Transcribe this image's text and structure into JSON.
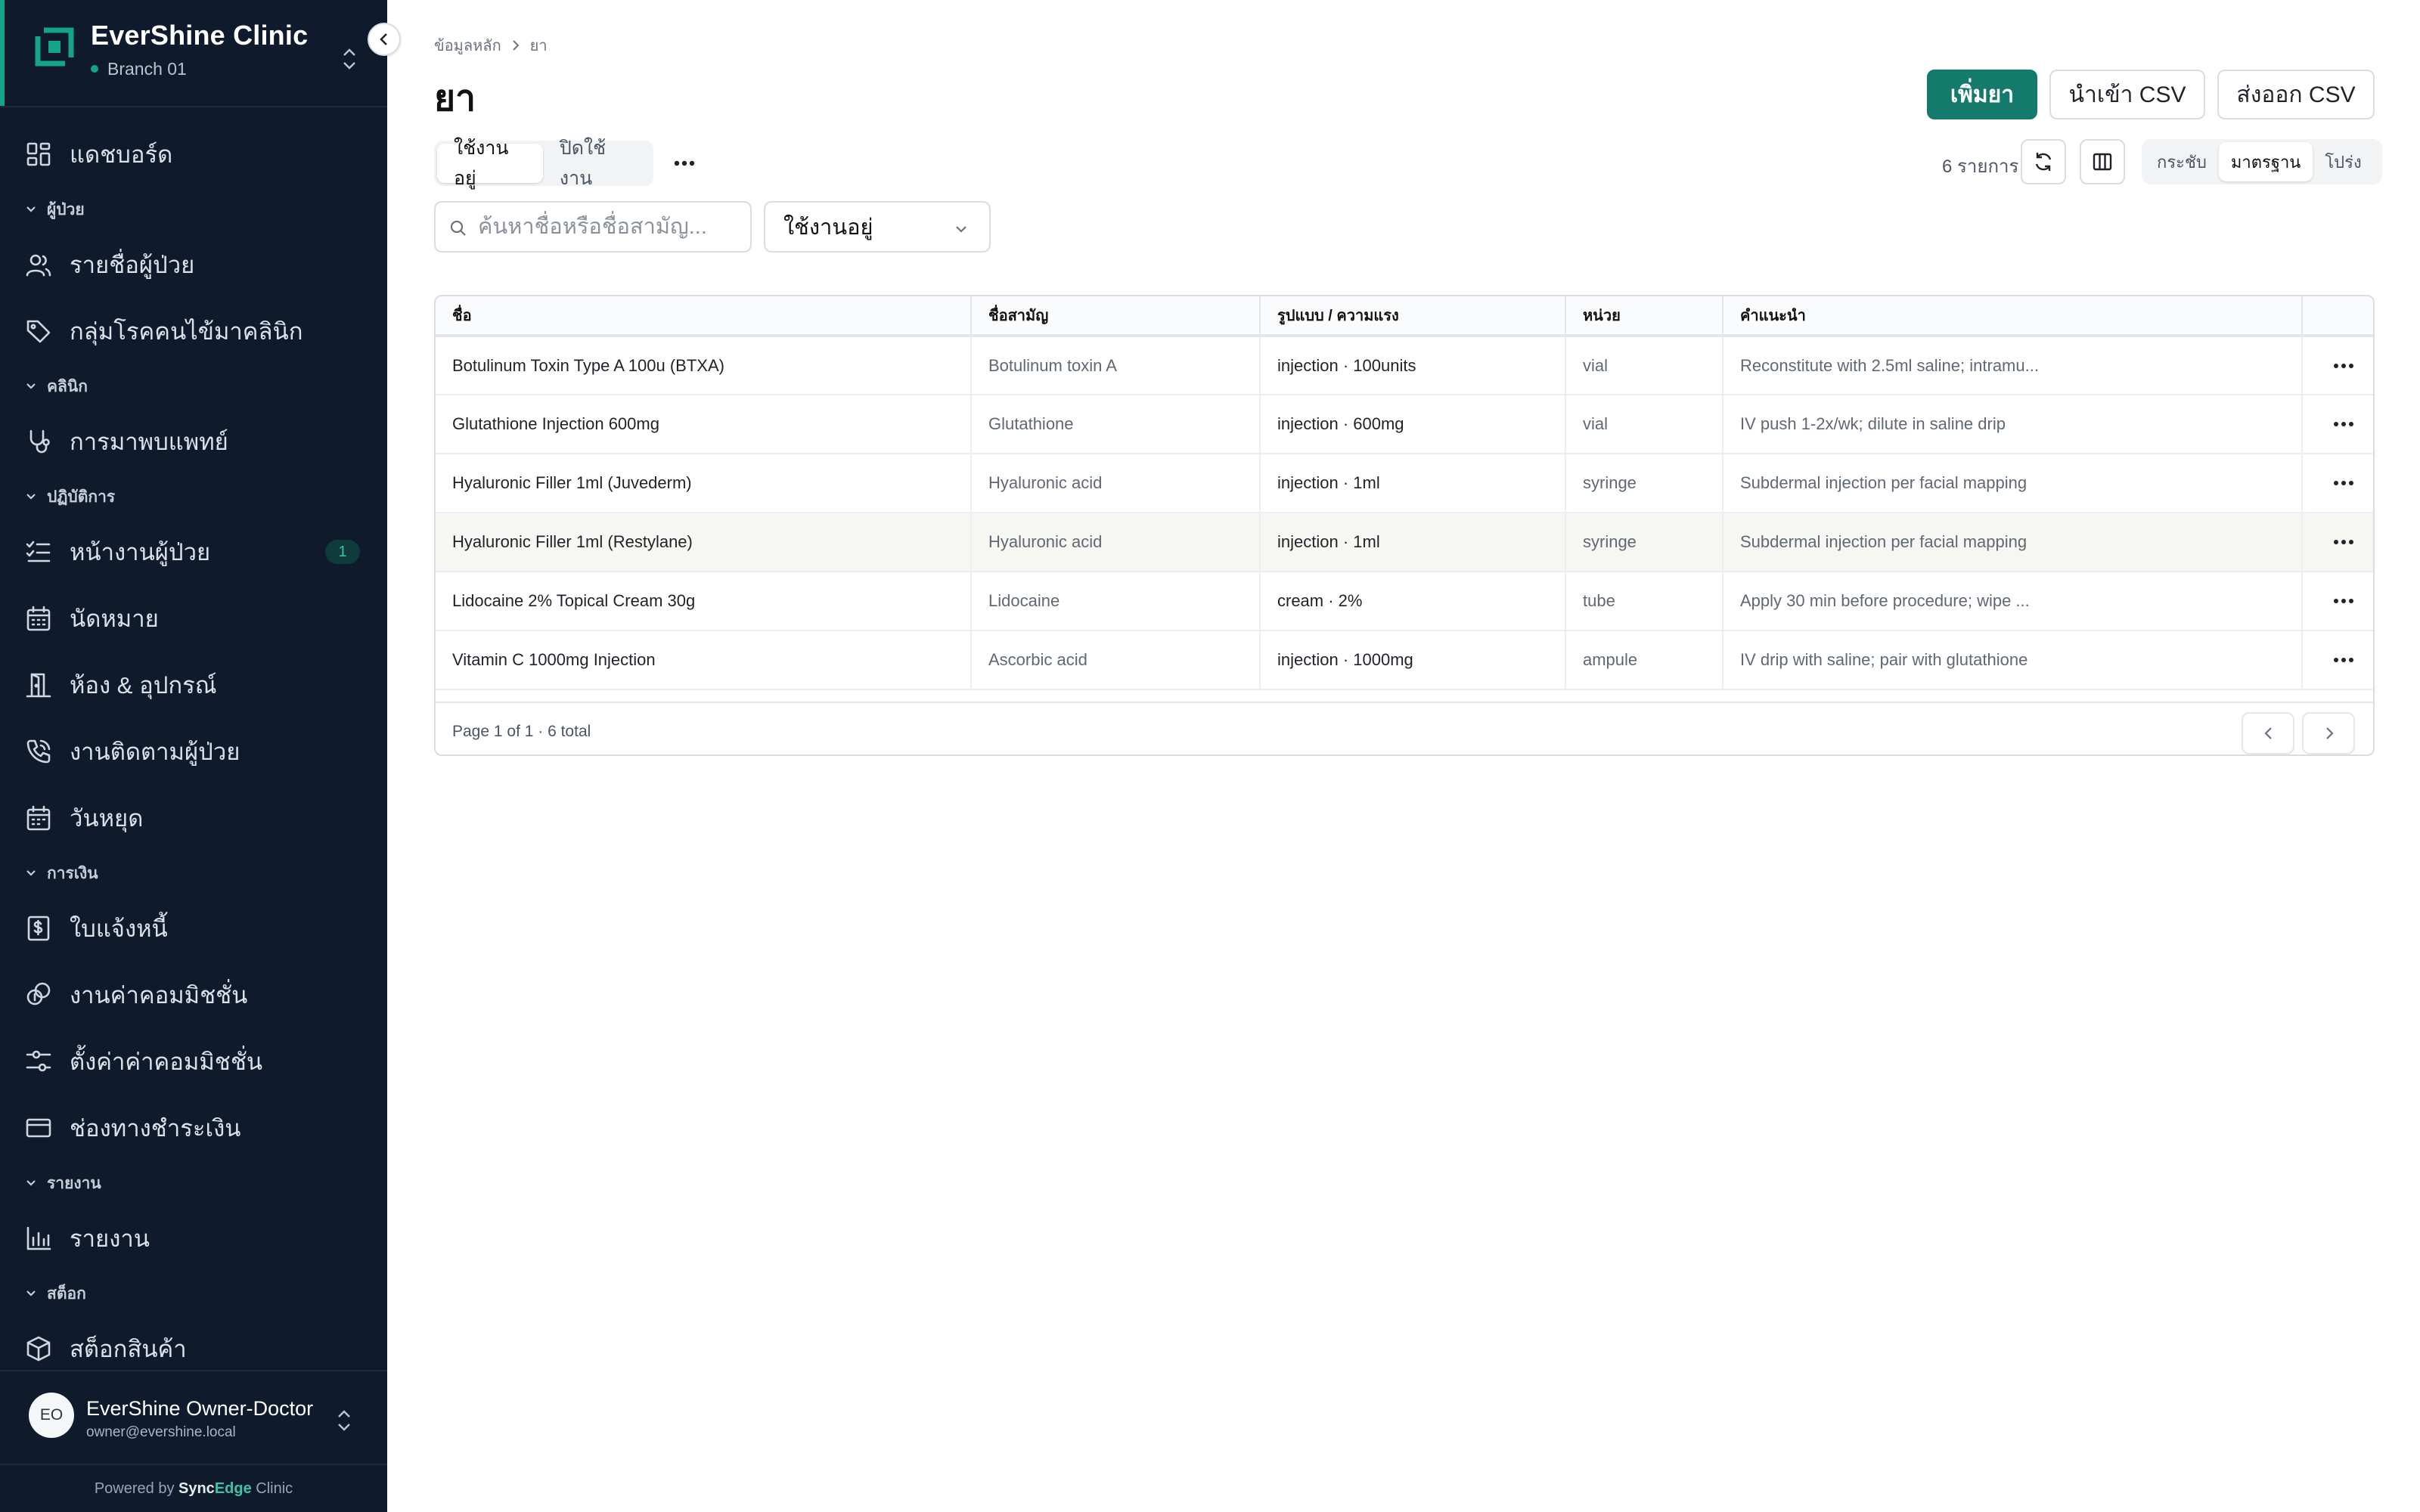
{
  "sidebar": {
    "brand_name": "EverShine Clinic",
    "branch": "Branch 01",
    "nav": [
      {
        "type": "item",
        "label": "แดชบอร์ด",
        "icon": "dashboard-icon"
      },
      {
        "type": "section",
        "label": "ผู้ป่วย"
      },
      {
        "type": "item",
        "label": "รายชื่อผู้ป่วย",
        "icon": "users-icon"
      },
      {
        "type": "item",
        "label": "กลุ่มโรคคนไข้มาคลินิก",
        "icon": "tag-icon"
      },
      {
        "type": "section",
        "label": "คลินิก"
      },
      {
        "type": "item",
        "label": "การมาพบแพทย์",
        "icon": "stethoscope-icon"
      },
      {
        "type": "section",
        "label": "ปฏิบัติการ"
      },
      {
        "type": "item",
        "label": "หน้างานผู้ป่วย",
        "icon": "checklist-icon",
        "badge": "1"
      },
      {
        "type": "item",
        "label": "นัดหมาย",
        "icon": "calendar-icon"
      },
      {
        "type": "item",
        "label": "ห้อง & อุปกรณ์",
        "icon": "door-icon"
      },
      {
        "type": "item",
        "label": "งานติดตามผู้ป่วย",
        "icon": "phone-icon"
      },
      {
        "type": "item",
        "label": "วันหยุด",
        "icon": "calendar-holiday-icon"
      },
      {
        "type": "section",
        "label": "การเงิน"
      },
      {
        "type": "item",
        "label": "ใบแจ้งหนี้",
        "icon": "invoice-icon"
      },
      {
        "type": "item",
        "label": "งานค่าคอมมิชชั่น",
        "icon": "coins-icon"
      },
      {
        "type": "item",
        "label": "ตั้งค่าค่าคอมมิชชั่น",
        "icon": "sliders-icon"
      },
      {
        "type": "item",
        "label": "ช่องทางชำระเงิน",
        "icon": "credit-card-icon"
      },
      {
        "type": "section",
        "label": "รายงาน"
      },
      {
        "type": "item",
        "label": "รายงาน",
        "icon": "bar-chart-icon"
      },
      {
        "type": "section",
        "label": "สต็อก"
      },
      {
        "type": "item",
        "label": "สต็อกสินค้า",
        "icon": "box-icon"
      }
    ],
    "user": {
      "initials": "EO",
      "name": "EverShine Owner-Doctor",
      "email": "owner@evershine.local"
    },
    "powered_prefix": "Powered by ",
    "powered_sync": "Sync",
    "powered_edge": "Edge",
    "powered_suffix": " Clinic"
  },
  "header": {
    "breadcrumb": [
      "ข้อมูลหลัก",
      "ยา"
    ],
    "title": "ยา",
    "add_button": "เพิ่มยา",
    "import_button": "นำเข้า CSV",
    "export_button": "ส่งออก CSV"
  },
  "toolbar": {
    "tabs": [
      "ใช้งานอยู่",
      "ปิดใช้งาน"
    ],
    "active_tab": 0,
    "count": "6 รายการ",
    "density": [
      "กระชับ",
      "มาตรฐาน",
      "โปร่ง"
    ],
    "active_density": 1,
    "search_placeholder": "ค้นหาชื่อหรือชื่อสามัญ...",
    "status_filter": "ใช้งานอยู่"
  },
  "table": {
    "columns": [
      "ชื่อ",
      "ชื่อสามัญ",
      "รูปแบบ / ความแรง",
      "หน่วย",
      "คำแนะนำ"
    ],
    "rows": [
      [
        "Botulinum Toxin Type A 100u (BTXA)",
        "Botulinum toxin A",
        "injection · 100units",
        "vial",
        "Reconstitute with 2.5ml saline; intramu..."
      ],
      [
        "Glutathione Injection 600mg",
        "Glutathione",
        "injection · 600mg",
        "vial",
        "IV push 1-2x/wk; dilute in saline drip"
      ],
      [
        "Hyaluronic Filler 1ml (Juvederm)",
        "Hyaluronic acid",
        "injection · 1ml",
        "syringe",
        "Subdermal injection per facial mapping"
      ],
      [
        "Hyaluronic Filler 1ml (Restylane)",
        "Hyaluronic acid",
        "injection · 1ml",
        "syringe",
        "Subdermal injection per facial mapping"
      ],
      [
        "Lidocaine 2% Topical Cream 30g",
        "Lidocaine",
        "cream · 2%",
        "tube",
        "Apply 30 min before procedure; wipe ..."
      ],
      [
        "Vitamin C 1000mg Injection",
        "Ascorbic acid",
        "injection · 1000mg",
        "ampule",
        "IV drip with saline; pair with glutathione"
      ]
    ],
    "highlight_row": 3,
    "page_info": "Page 1 of 1 · 6 total"
  },
  "colors": {
    "sidebar_bg": "#0f1b2d",
    "accent": "#147a6b",
    "teal": "#14a38b"
  }
}
